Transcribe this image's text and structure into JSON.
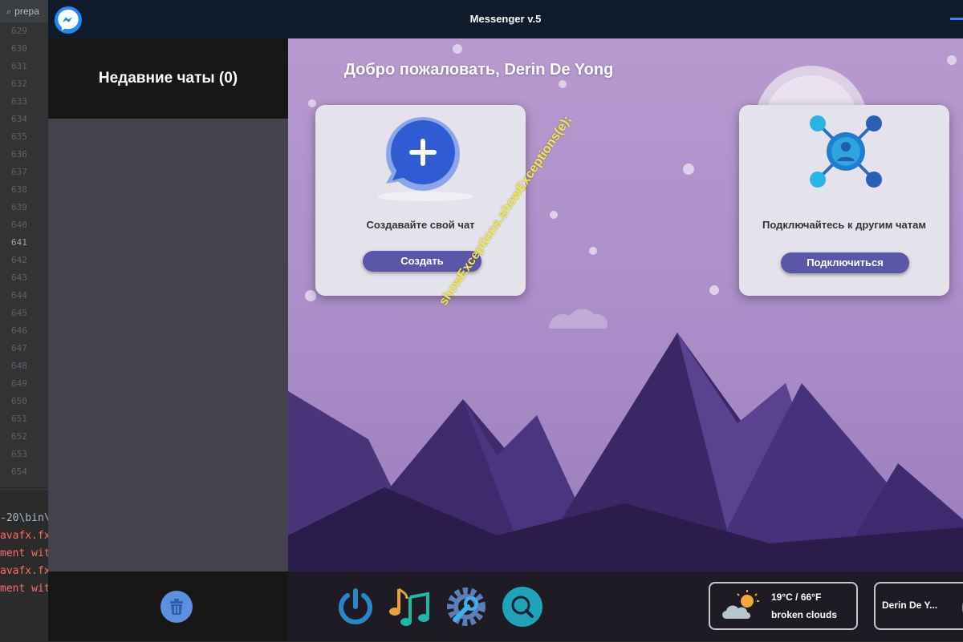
{
  "ide": {
    "search_text": "prepa",
    "line_numbers": [
      "629",
      "630",
      "631",
      "632",
      "633",
      "634",
      "635",
      "636",
      "637",
      "638",
      "639",
      "640",
      "641",
      "642",
      "643",
      "644",
      "645",
      "646",
      "647",
      "648",
      "649",
      "650",
      "651",
      "652",
      "653",
      "654"
    ],
    "current_line": "641",
    "console_lines": [
      "-20\\bin\\",
      "avafx.fx",
      "ment wit",
      "avafx.fx",
      "ment wit"
    ]
  },
  "window": {
    "title": "Messenger v.5"
  },
  "sidebar": {
    "header": "Недавние чаты (0)"
  },
  "main": {
    "welcome": "Добро пожаловать, Derin De Yong",
    "create_card": {
      "text": "Создавайте свой чат",
      "button": "Создать"
    },
    "connect_card": {
      "text": "Подключайтесь к другим чатам",
      "button": "Подключиться"
    },
    "overlay_text": "showExceptions.showExceptions(e);"
  },
  "taskbar": {
    "icons": [
      "power-icon",
      "music-icon",
      "settings-icon",
      "search-icon"
    ],
    "weather": {
      "temp": "19°C / 66°F",
      "description": "broken clouds"
    },
    "user": {
      "name": "Derin De Y..."
    }
  },
  "colors": {
    "titlebar": "#0f1a2a",
    "accent_button": "#5a57a9",
    "sidebar_dark": "#171717",
    "overlay_text": "#f5e945"
  }
}
